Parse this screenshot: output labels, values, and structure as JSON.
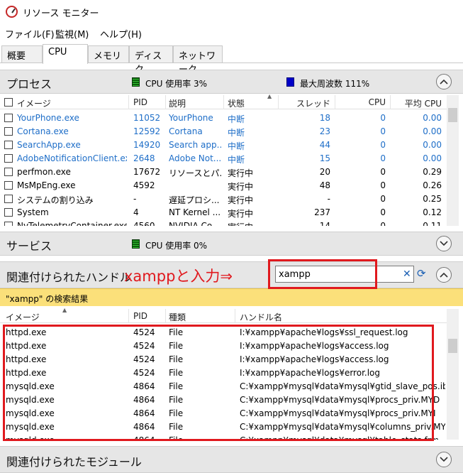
{
  "window": {
    "title": "リソース モニター"
  },
  "menu": [
    "ファイル(F)",
    "監視(M)",
    "ヘルプ(H)"
  ],
  "tabs": [
    "概要",
    "CPU",
    "メモリ",
    "ディスク",
    "ネットワーク"
  ],
  "active_tab": "CPU",
  "process_section": {
    "title": "プロセス",
    "cpu_usage": "CPU 使用率 3%",
    "max_freq": "最大周波数 111%",
    "columns": [
      "イメージ",
      "PID",
      "説明",
      "状態",
      "スレッド",
      "CPU",
      "平均 CPU"
    ],
    "rows": [
      {
        "image": "YourPhone.exe",
        "pid": "11052",
        "desc": "YourPhone",
        "status": "中断",
        "threads": "18",
        "cpu": "0",
        "avg": "0.00",
        "suspended": true
      },
      {
        "image": "Cortana.exe",
        "pid": "12592",
        "desc": "Cortana",
        "status": "中断",
        "threads": "23",
        "cpu": "0",
        "avg": "0.00",
        "suspended": true
      },
      {
        "image": "SearchApp.exe",
        "pid": "14920",
        "desc": "Search app...",
        "status": "中断",
        "threads": "44",
        "cpu": "0",
        "avg": "0.00",
        "suspended": true
      },
      {
        "image": "AdobeNotificationClient.exe",
        "pid": "2648",
        "desc": "Adobe Not...",
        "status": "中断",
        "threads": "15",
        "cpu": "0",
        "avg": "0.00",
        "suspended": true
      },
      {
        "image": "perfmon.exe",
        "pid": "17672",
        "desc": "リソースとパ...",
        "status": "実行中",
        "threads": "20",
        "cpu": "0",
        "avg": "0.29",
        "suspended": false
      },
      {
        "image": "MsMpEng.exe",
        "pid": "4592",
        "desc": "",
        "status": "実行中",
        "threads": "48",
        "cpu": "0",
        "avg": "0.26",
        "suspended": false
      },
      {
        "image": "システムの割り込み",
        "pid": "-",
        "desc": "遅延プロシ...",
        "status": "実行中",
        "threads": "-",
        "cpu": "0",
        "avg": "0.25",
        "suspended": false
      },
      {
        "image": "System",
        "pid": "4",
        "desc": "NT Kernel ...",
        "status": "実行中",
        "threads": "237",
        "cpu": "0",
        "avg": "0.12",
        "suspended": false
      },
      {
        "image": "NvTelemetryContainer.exe",
        "pid": "4560",
        "desc": "NVIDIA Co...",
        "status": "実行中",
        "threads": "14",
        "cpu": "0",
        "avg": "0.11",
        "suspended": false
      }
    ]
  },
  "services_section": {
    "title": "サービス",
    "cpu_usage": "CPU 使用率 0%"
  },
  "handles_section": {
    "title": "関連付けられたハンドル",
    "search_value": "xampp",
    "results_label": "\"xampp\" の検索結果",
    "columns": [
      "イメージ",
      "PID",
      "種類",
      "ハンドル名"
    ],
    "rows": [
      {
        "image": "httpd.exe",
        "pid": "4524",
        "type": "File",
        "handle": "I:¥xampp¥apache¥logs¥ssl_request.log"
      },
      {
        "image": "httpd.exe",
        "pid": "4524",
        "type": "File",
        "handle": "I:¥xampp¥apache¥logs¥access.log"
      },
      {
        "image": "httpd.exe",
        "pid": "4524",
        "type": "File",
        "handle": "I:¥xampp¥apache¥logs¥access.log"
      },
      {
        "image": "httpd.exe",
        "pid": "4524",
        "type": "File",
        "handle": "I:¥xampp¥apache¥logs¥error.log"
      },
      {
        "image": "mysqld.exe",
        "pid": "4864",
        "type": "File",
        "handle": "C:¥xampp¥mysql¥data¥mysql¥gtid_slave_pos.ibd"
      },
      {
        "image": "mysqld.exe",
        "pid": "4864",
        "type": "File",
        "handle": "C:¥xampp¥mysql¥data¥mysql¥procs_priv.MYD"
      },
      {
        "image": "mysqld.exe",
        "pid": "4864",
        "type": "File",
        "handle": "C:¥xampp¥mysql¥data¥mysql¥procs_priv.MYI"
      },
      {
        "image": "mysqld.exe",
        "pid": "4864",
        "type": "File",
        "handle": "C:¥xampp¥mysql¥data¥mysql¥columns_priv.MYI"
      },
      {
        "image": "mysqld.exe",
        "pid": "4864",
        "type": "File",
        "handle": "C:¥xampp¥mysql¥data¥mysql¥table_stats.frm"
      }
    ]
  },
  "modules_section": {
    "title": "関連付けられたモジュール"
  },
  "annotation": {
    "text": "xamppと入力⇒",
    "color": "#e0191e"
  },
  "colors": {
    "suspended_text": "#1e6ec8",
    "results_bar": "#fbe07a",
    "annotation": "#e0191e"
  }
}
